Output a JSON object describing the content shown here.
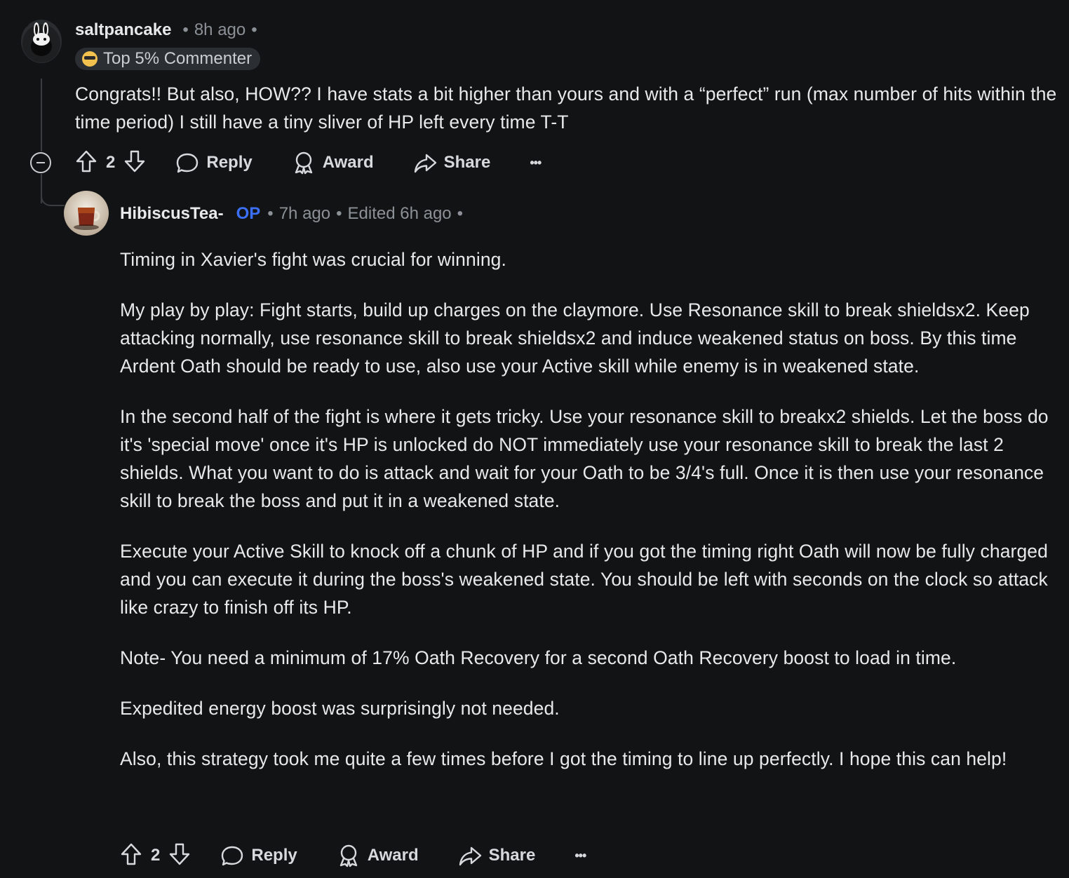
{
  "comment1": {
    "username": "saltpancake",
    "time": "8h ago",
    "flair": "Top 5% Commenter",
    "body": "Congrats!! But also, HOW?? I have stats a bit higher than yours and with a “perfect” run (max number of hits within the time period) I still have a tiny sliver of HP left every time T-T",
    "votes": "2",
    "reply_label": "Reply",
    "award_label": "Award",
    "share_label": "Share",
    "more_label": "•••"
  },
  "comment2": {
    "username": "HibiscusTea-",
    "op_badge": "OP",
    "time": "7h ago",
    "edited": "Edited 6h ago",
    "paragraphs": [
      "Timing in Xavier's fight was crucial for winning.",
      "My play by play: Fight starts, build up charges on the claymore. Use Resonance skill to break shieldsx2. Keep attacking normally, use resonance skill to break shieldsx2 and induce weakened status on boss. By this time Ardent Oath should be ready to use, also use your Active skill while enemy is in weakened state.",
      "In the second half of the fight is where it gets tricky. Use your resonance skill to breakx2 shields. Let the boss do it's 'special move' once it's HP is unlocked do NOT immediately use your resonance skill to break the last 2 shields. What you want to do is attack and wait for your Oath to be 3/4's full. Once it is then use your resonance skill to break the boss and put it in a weakened state.",
      "Execute your Active Skill to knock off a chunk of HP and if you got the timing right Oath will now be fully charged and you can execute it during the boss's weakened state. You should be left with seconds on the clock so attack like crazy to finish off its HP.",
      "Note- You need a minimum of 17% Oath Recovery for a second Oath Recovery boost to load in time.",
      "Expedited energy boost was surprisingly not needed.",
      "Also, this strategy took me quite a few times before I got the timing to line up perfectly. I hope this can help!"
    ],
    "votes": "2",
    "reply_label": "Reply",
    "award_label": "Award",
    "share_label": "Share",
    "more_label": "•••"
  },
  "colors": {
    "background": "#121314",
    "text": "#e7e9ea",
    "meta": "#8b9196",
    "op": "#3b6ff5"
  }
}
